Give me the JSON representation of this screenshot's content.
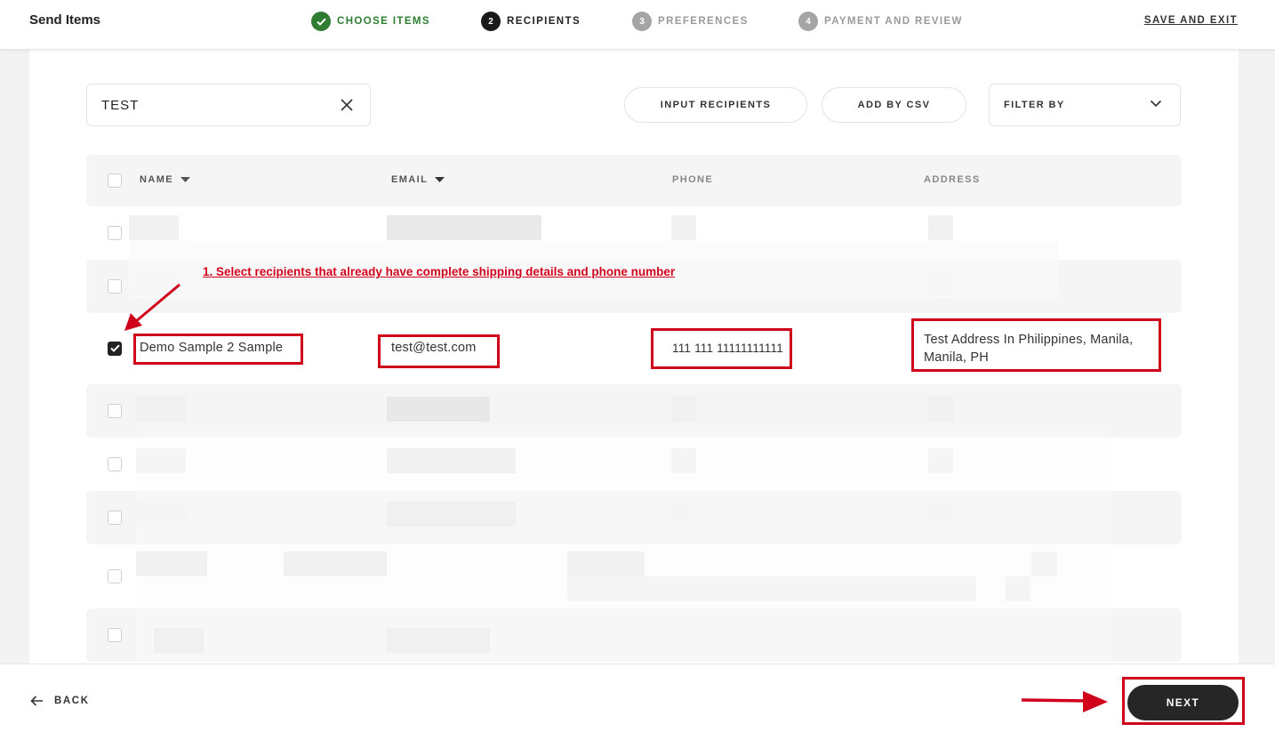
{
  "header": {
    "title": "Send Items",
    "steps": [
      {
        "num": "✓",
        "label": "CHOOSE ITEMS",
        "state": "done"
      },
      {
        "num": "2",
        "label": "RECIPIENTS",
        "state": "active"
      },
      {
        "num": "3",
        "label": "PREFERENCES",
        "state": "todo"
      },
      {
        "num": "4",
        "label": "PAYMENT AND REVIEW",
        "state": "todo"
      }
    ],
    "save_exit": "SAVE AND EXIT"
  },
  "toolbar": {
    "search_value": "TEST",
    "input_recipients": "INPUT RECIPIENTS",
    "add_by_csv": "ADD BY CSV",
    "filter_by": "FILTER BY"
  },
  "table": {
    "columns": [
      "NAME",
      "EMAIL",
      "PHONE",
      "ADDRESS"
    ],
    "selected_row": {
      "name": "Demo Sample 2 Sample",
      "email": "test@test.com",
      "phone": "111 111 11111111111",
      "address": "Test Address In Philippines, Manila, Manila, PH"
    }
  },
  "annotation": "1. Select recipients that already have complete shipping details and phone number",
  "footer": {
    "back": "BACK",
    "next": "NEXT"
  },
  "colors": {
    "done_green": "#2e7d32",
    "highlight_red": "#d0021b",
    "next_bg": "#262626"
  }
}
